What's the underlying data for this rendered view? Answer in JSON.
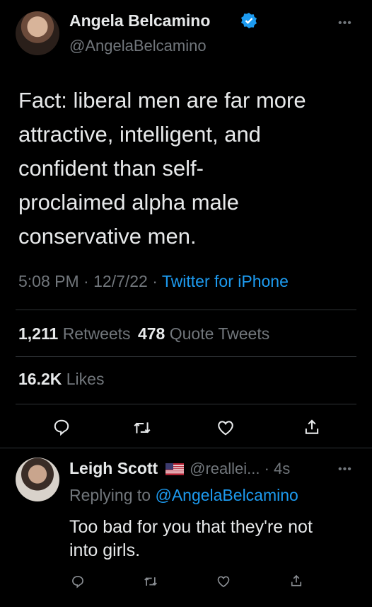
{
  "main_tweet": {
    "author_name": "Angela Belcamino",
    "handle": "@AngelaBelcamino",
    "text_lines": [
      "Fact: liberal men are far more",
      "attractive, intelligent, and",
      "confident than self-",
      "proclaimed alpha male",
      "conservative men."
    ],
    "time": "5:08 PM",
    "date": "12/7/22",
    "source": "Twitter for iPhone",
    "retweets_count": "1,211",
    "retweets_label": "Retweets",
    "quotes_count": "478",
    "quotes_label": "Quote Tweets",
    "likes_count": "16.2K",
    "likes_label": "Likes",
    "sep": "·"
  },
  "reply": {
    "author_name": "Leigh Scott",
    "handle_time": "@reallei... · 4s",
    "replying_prefix": "Replying to",
    "replying_handle": "@AngelaBelcamino",
    "text_lines": [
      "Too bad for you that they're not",
      "into girls."
    ]
  },
  "icons": {
    "verified": "verified-badge-icon",
    "more": "more-icon",
    "reply": "reply-icon",
    "retweet": "retweet-icon",
    "like": "like-icon",
    "share": "share-icon",
    "flag": "us-flag-icon"
  },
  "colors": {
    "background": "#000000",
    "text": "#e7e9ea",
    "secondary": "#71767b",
    "accent": "#1d9bf0"
  }
}
